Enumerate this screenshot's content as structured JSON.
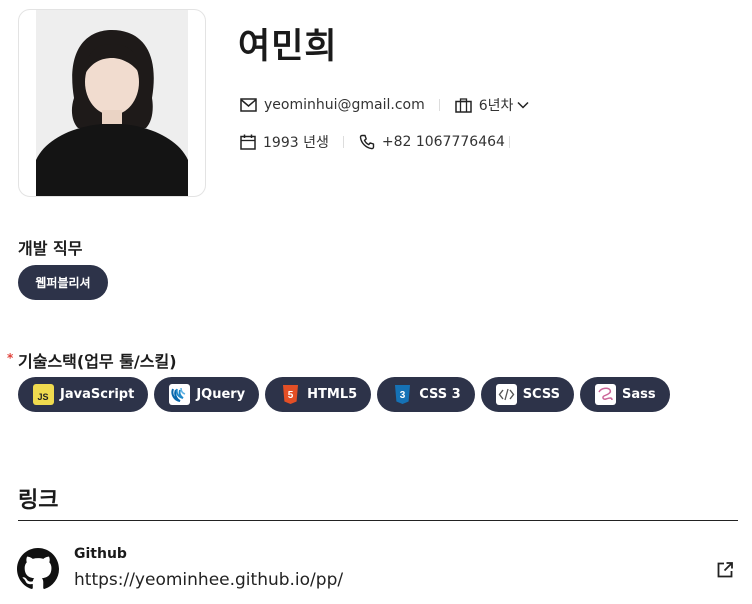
{
  "profile": {
    "name": "여민희",
    "email": "yeominhui@gmail.com",
    "experience": "6년차",
    "birth": "1993 년생",
    "phone": "+82 1067776464"
  },
  "job": {
    "label": "개발 직무",
    "role": "웹퍼블리셔"
  },
  "skills": {
    "label": "기술스택(업무 툴/스킬)",
    "required_mark": "*",
    "items": [
      {
        "label": "JavaScript",
        "icon": "javascript-icon",
        "color": "#f0db4f"
      },
      {
        "label": "JQuery",
        "icon": "jquery-icon",
        "color": "#0868ac"
      },
      {
        "label": "HTML5",
        "icon": "html5-icon",
        "color": "#e34f26"
      },
      {
        "label": "CSS 3",
        "icon": "css3-icon",
        "color": "#1572b6"
      },
      {
        "label": "SCSS",
        "icon": "code-icon",
        "color": "#ffffff"
      },
      {
        "label": "Sass",
        "icon": "sass-icon",
        "color": "#cc6699"
      }
    ]
  },
  "links": {
    "title": "링크",
    "items": [
      {
        "name": "Github",
        "url": "https://yeominhee.github.io/pp/",
        "icon": "github-icon"
      }
    ]
  },
  "colors": {
    "chip_bg": "#2d3349",
    "required": "#e0413a"
  }
}
